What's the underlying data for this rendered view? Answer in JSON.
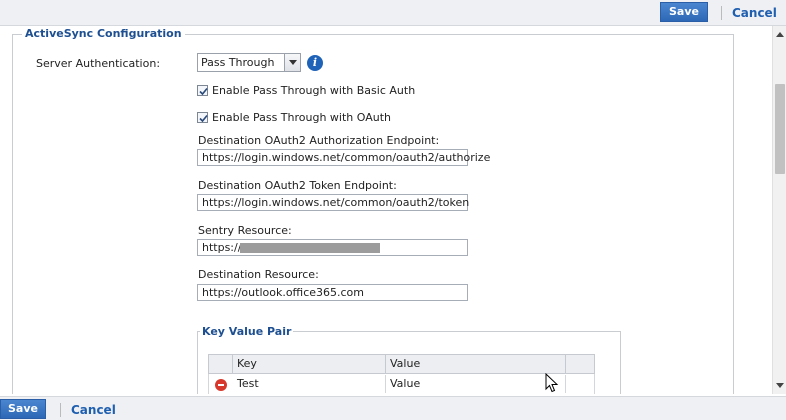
{
  "toolbar": {
    "save_label": "Save",
    "cancel_label": "Cancel"
  },
  "section": {
    "title": "ActiveSync Configuration"
  },
  "form": {
    "server_auth_label": "Server Authentication:",
    "server_auth_value": "Pass Through",
    "basic_auth_label": "Enable Pass Through with Basic Auth",
    "basic_auth_checked": true,
    "oauth_label": "Enable Pass Through with OAuth",
    "oauth_checked": true,
    "auth_endpoint_label": "Destination OAuth2 Authorization Endpoint:",
    "auth_endpoint_value": "https://login.windows.net/common/oauth2/authorize",
    "token_endpoint_label": "Destination OAuth2 Token Endpoint:",
    "token_endpoint_value": "https://login.windows.net/common/oauth2/token",
    "sentry_resource_label": "Sentry Resource:",
    "sentry_resource_value": "https://",
    "dest_resource_label": "Destination Resource:",
    "dest_resource_value": "https://outlook.office365.com"
  },
  "kvp": {
    "title": "Key Value Pair",
    "columns": [
      "Key",
      "Value"
    ],
    "rows": [
      {
        "key": "Test",
        "value": "Value"
      }
    ]
  },
  "icons": {
    "info": "info-icon",
    "remove": "remove-icon",
    "dropdown": "chevron-down-icon"
  },
  "colors": {
    "accent": "#2c68b5",
    "link": "#1f5fb0",
    "section_title": "#1d4f91"
  }
}
